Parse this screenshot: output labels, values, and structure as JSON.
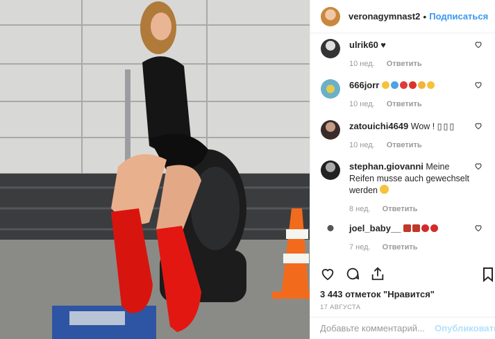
{
  "post": {
    "username": "veronagymnast2",
    "follow_label": "Подписаться",
    "likes_text": "3 443 отметок \"Нравится\"",
    "date_text": "17 АВГУСТА",
    "comment_placeholder": "Добавьте комментарий...",
    "publish_label": "Опубликовать"
  },
  "comments": [
    {
      "user": "ulrik60",
      "text": "♥",
      "age": "10 нед.",
      "reply": "Ответить"
    },
    {
      "user": "666jorr",
      "text": "",
      "age": "10 нед.",
      "reply": "Ответить"
    },
    {
      "user": "zatouichi4649",
      "text": "Wow ! ",
      "age": "10 нед.",
      "reply": "Ответить"
    },
    {
      "user": "stephan.giovanni",
      "text": "Meine Reifen musse auch gewechselt werden",
      "age": "8 нед.",
      "reply": "Ответить"
    },
    {
      "user": "joel_baby__",
      "text": "",
      "age": "7 нед.",
      "reply": "Ответить"
    }
  ],
  "icons": {
    "like": "heart-icon",
    "comment": "comment-icon",
    "share": "share-icon",
    "save": "bookmark-icon"
  }
}
